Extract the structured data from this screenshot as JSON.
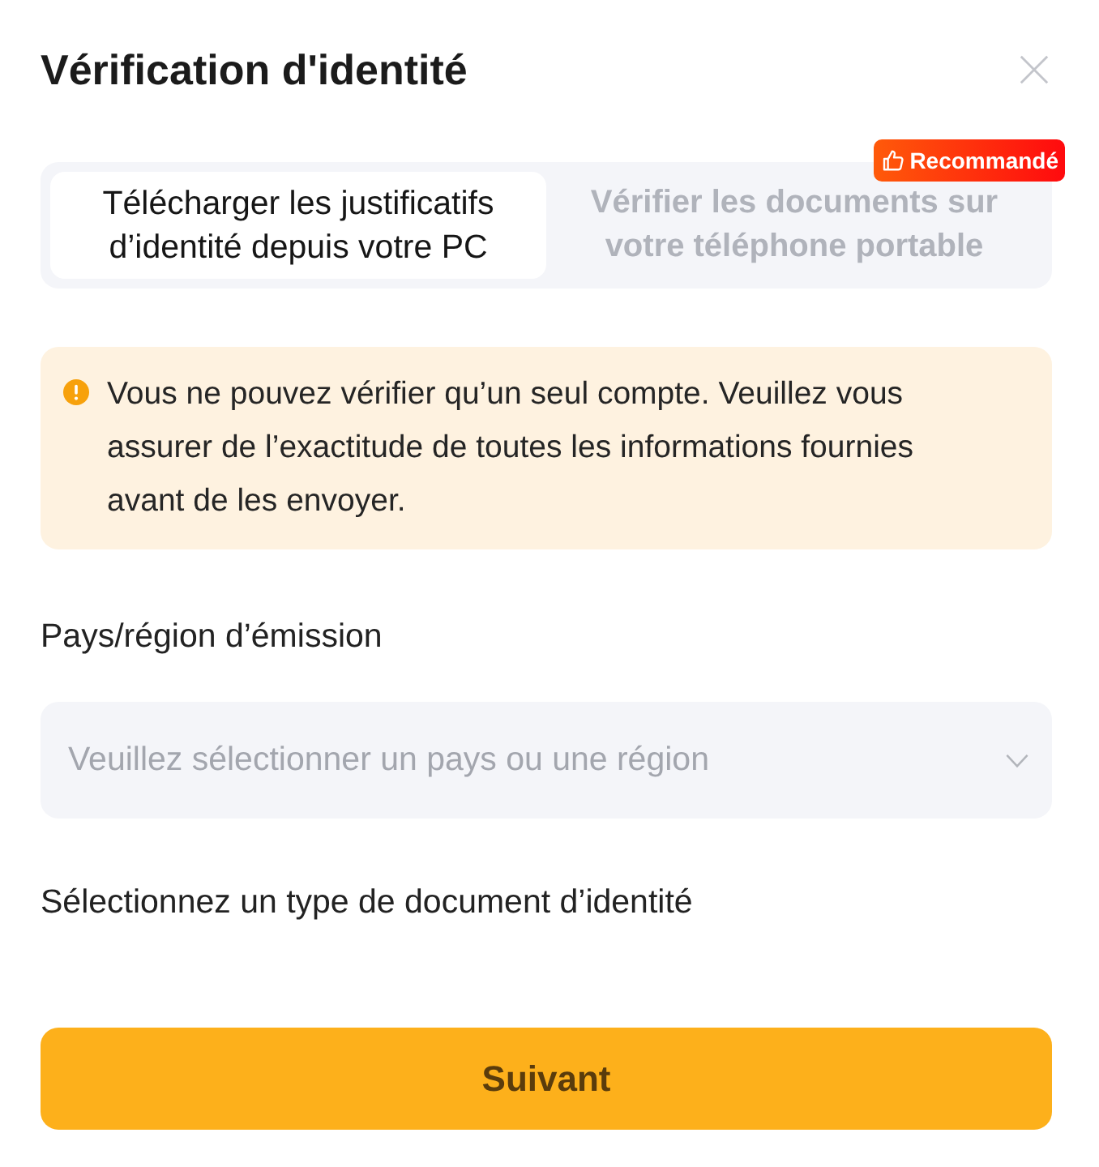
{
  "dialog": {
    "title": "Vérification d'identité"
  },
  "tabs": [
    {
      "label": "Télécharger les justificatifs d’identité depuis votre PC",
      "selected": true
    },
    {
      "label": "Vérifier les documents sur votre téléphone portable",
      "selected": false,
      "badge": "Recommandé"
    }
  ],
  "notice": {
    "text": "Vous ne pouvez vérifier qu’un seul compte. Veuillez vous assurer de l’exactitude de toutes les informations fournies avant de les envoyer."
  },
  "fields": [
    {
      "kind": "select",
      "label": "Pays/région d’émission",
      "placeholder": "Veuillez sélectionner un pays ou une région"
    },
    {
      "kind": "section",
      "label": "Sélectionnez un type de document d’identité"
    }
  ],
  "primary_button": {
    "label": "Suivant"
  }
}
